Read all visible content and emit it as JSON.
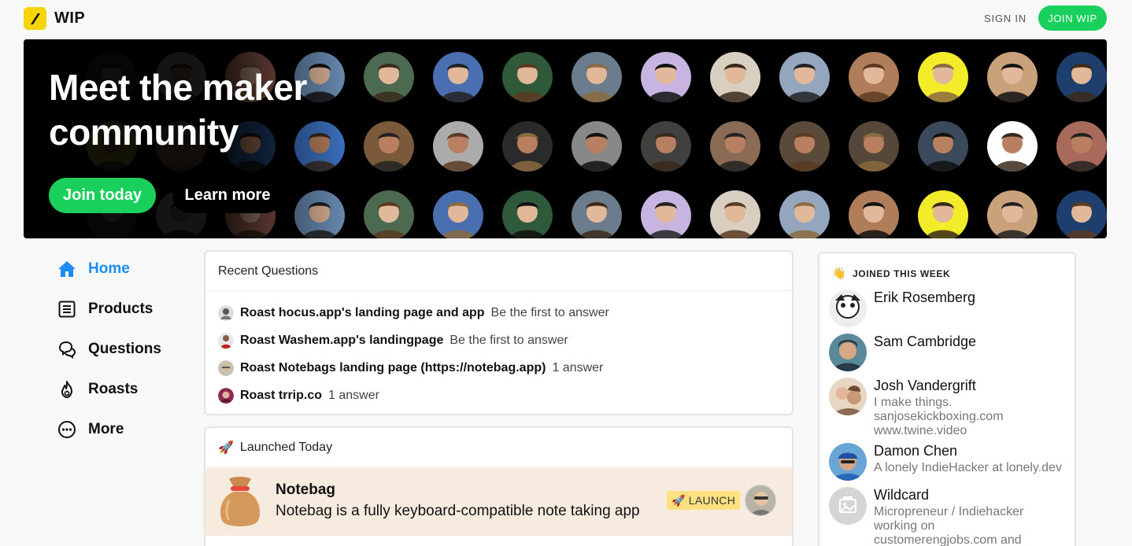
{
  "header": {
    "brand": "WIP",
    "signin": "SIGN IN",
    "join": "JOIN WIP"
  },
  "hero": {
    "title_line1": "Meet the maker",
    "title_line2": "community",
    "join_label": "Join today",
    "learn_label": "Learn more"
  },
  "nav": {
    "items": [
      {
        "label": "Home",
        "icon": "home-icon"
      },
      {
        "label": "Products",
        "icon": "list-icon"
      },
      {
        "label": "Questions",
        "icon": "chat-bubbles-icon"
      },
      {
        "label": "Roasts",
        "icon": "flame-icon"
      },
      {
        "label": "More",
        "icon": "more-dots-icon"
      }
    ]
  },
  "questions": {
    "heading": "Recent Questions",
    "items": [
      {
        "title": "Roast hocus.app's landing page and app",
        "meta": "Be the first to answer"
      },
      {
        "title": "Roast Washem.app's landingpage",
        "meta": "Be the first to answer"
      },
      {
        "title": "Roast Notebags landing page (https://notebag.app)",
        "meta": "1 answer"
      },
      {
        "title": "Roast trrip.co",
        "meta": "1 answer"
      }
    ]
  },
  "launched": {
    "heading": "Launched Today",
    "product": {
      "name": "Notebag",
      "description": "Notebag is a fully keyboard-compatible note taking app",
      "badge": "LAUNCH"
    }
  },
  "joined": {
    "heading": "JOINED THIS WEEK",
    "users": [
      {
        "name": "Erik Rosemberg",
        "bio": []
      },
      {
        "name": "Sam Cambridge",
        "bio": []
      },
      {
        "name": "Josh Vandergrift",
        "bio": [
          "I make things.",
          "sanjosekickboxing.com",
          "www.twine.video"
        ]
      },
      {
        "name": "Damon Chen",
        "bio": [
          "A lonely IndieHacker at lonely.dev"
        ]
      },
      {
        "name": "Wildcard",
        "bio": [
          "Micropreneur / Indiehacker",
          "working on",
          "customerengjobs.com and"
        ]
      }
    ]
  },
  "colors": {
    "accent_green": "#18d05b",
    "active_blue": "#1a8cf5",
    "brand_yellow": "#f5d50a",
    "launch_bg": "#f7ebe0"
  }
}
